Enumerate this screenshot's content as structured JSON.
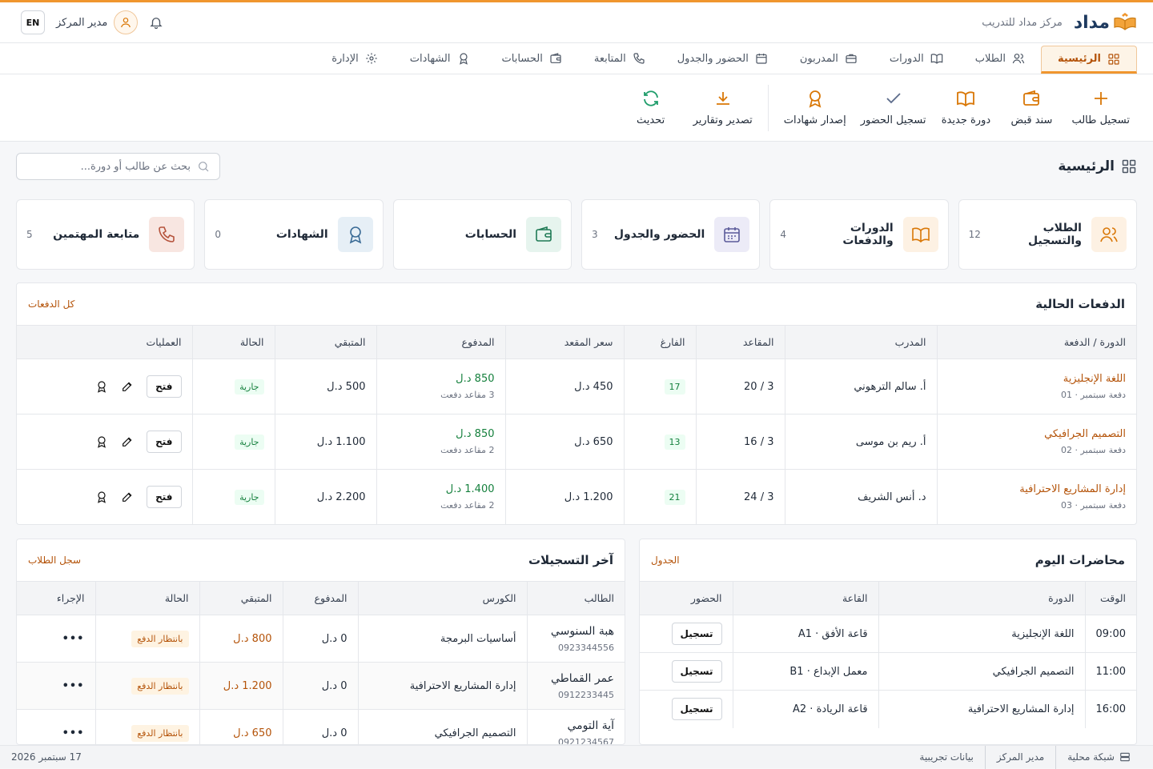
{
  "header": {
    "logo_text": "مداد",
    "center_name": "مركز مداد للتدريب",
    "user_name": "مدير المركز",
    "lang_button": "EN"
  },
  "nav": {
    "tabs": [
      {
        "label": "الرئيسية",
        "icon": "grid-icon",
        "active": true
      },
      {
        "label": "الطلاب",
        "icon": "users-icon"
      },
      {
        "label": "الدورات",
        "icon": "book-icon"
      },
      {
        "label": "المدربون",
        "icon": "briefcase-icon"
      },
      {
        "label": "الحضور والجدول",
        "icon": "calendar-icon"
      },
      {
        "label": "المتابعة",
        "icon": "phone-icon"
      },
      {
        "label": "الحسابات",
        "icon": "wallet-icon"
      },
      {
        "label": "الشهادات",
        "icon": "award-icon"
      },
      {
        "label": "الإدارة",
        "icon": "gear-icon"
      }
    ]
  },
  "actions": {
    "add_student": "تسجيل طالب",
    "receipt": "سند قبض",
    "new_course": "دورة جديدة",
    "attendance": "تسجيل الحضور",
    "certificates": "إصدار شهادات",
    "export": "تصدير وتقارير",
    "refresh": "تحديث"
  },
  "page": {
    "title": "الرئيسية",
    "search_placeholder": "بحث عن طالب أو دورة..."
  },
  "cards": [
    {
      "label": "الطلاب والتسجيل",
      "count": "12",
      "icon": "users-icon",
      "bg": "#fdf1e3",
      "fg": "#d97706"
    },
    {
      "label": "الدورات والدفعات",
      "count": "4",
      "icon": "book-icon",
      "bg": "#fdf1e3",
      "fg": "#d97706"
    },
    {
      "label": "الحضور والجدول",
      "count": "3",
      "icon": "calendar-icon",
      "bg": "#ecebf7",
      "fg": "#5b5b9a"
    },
    {
      "label": "الحسابات",
      "count": "",
      "icon": "wallet-icon",
      "bg": "#e6f4ee",
      "fg": "#1f7a55"
    },
    {
      "label": "الشهادات",
      "count": "0",
      "icon": "award-icon",
      "bg": "#e6eff6",
      "fg": "#3a6b96"
    },
    {
      "label": "متابعة المهتمين",
      "count": "5",
      "icon": "phone-icon",
      "bg": "#f8e6e1",
      "fg": "#b5533c"
    }
  ],
  "batches": {
    "title": "الدفعات الحالية",
    "link": "كل الدفعات",
    "headers": [
      "الدورة / الدفعة",
      "المدرب",
      "المقاعد",
      "الفارغ",
      "سعر المقعد",
      "المدفوع",
      "المتبقي",
      "الحالة",
      "العمليات"
    ],
    "open_label": "فتح",
    "rows": [
      {
        "course": "اللغة الإنجليزية",
        "batch": "دفعة سبتمبر · 01",
        "trainer": "أ. سالم الترهوني",
        "seats": "3 / 20",
        "empty": "17",
        "price": "450 د.ل",
        "paid": "850 د.ل",
        "paid_sub": "3 مقاعد دفعت",
        "remaining": "500 د.ل",
        "status": "جارية"
      },
      {
        "course": "التصميم الجرافيكي",
        "batch": "دفعة سبتمبر · 02",
        "trainer": "أ. ريم بن موسى",
        "seats": "3 / 16",
        "empty": "13",
        "price": "650 د.ل",
        "paid": "850 د.ل",
        "paid_sub": "2 مقاعد دفعت",
        "remaining": "1.100 د.ل",
        "status": "جارية"
      },
      {
        "course": "إدارة المشاريع الاحترافية",
        "batch": "دفعة سبتمبر · 03",
        "trainer": "د. أنس الشريف",
        "seats": "3 / 24",
        "empty": "21",
        "price": "1.200 د.ل",
        "paid": "1.400 د.ل",
        "paid_sub": "2 مقاعد دفعت",
        "remaining": "2.200 د.ل",
        "status": "جارية"
      }
    ]
  },
  "lectures": {
    "title": "محاضرات اليوم",
    "link": "الجدول",
    "headers": [
      "الوقت",
      "الدورة",
      "القاعة",
      "الحضور"
    ],
    "button_label": "تسجيل",
    "rows": [
      {
        "time": "09:00",
        "course": "اللغة الإنجليزية",
        "room": "قاعة الأفق · A1"
      },
      {
        "time": "11:00",
        "course": "التصميم الجرافيكي",
        "room": "معمل الإبداع · B1"
      },
      {
        "time": "16:00",
        "course": "إدارة المشاريع الاحترافية",
        "room": "قاعة الريادة · A2"
      }
    ]
  },
  "registrations": {
    "title": "آخر التسجيلات",
    "link": "سجل الطلاب",
    "headers": [
      "الطالب",
      "الكورس",
      "المدفوع",
      "المتبقي",
      "الحالة",
      "الإجراء"
    ],
    "rows": [
      {
        "name": "هبة السنوسي",
        "phone": "0923344556",
        "course": "أساسيات البرمجة",
        "paid": "0 د.ل",
        "remaining": "800 د.ل",
        "status": "بانتظار الدفع"
      },
      {
        "name": "عمر القماطي",
        "phone": "0912233445",
        "course": "إدارة المشاريع الاحترافية",
        "paid": "0 د.ل",
        "remaining": "1.200 د.ل",
        "status": "بانتظار الدفع"
      },
      {
        "name": "آية التومي",
        "phone": "0921234567",
        "course": "التصميم الجرافيكي",
        "paid": "0 د.ل",
        "remaining": "650 د.ل",
        "status": "بانتظار الدفع"
      }
    ]
  },
  "statusbar": {
    "network": "شبكة محلية",
    "role": "مدير المركز",
    "mode": "بيانات تجريبية",
    "date": "17 سبتمبر 2026"
  }
}
